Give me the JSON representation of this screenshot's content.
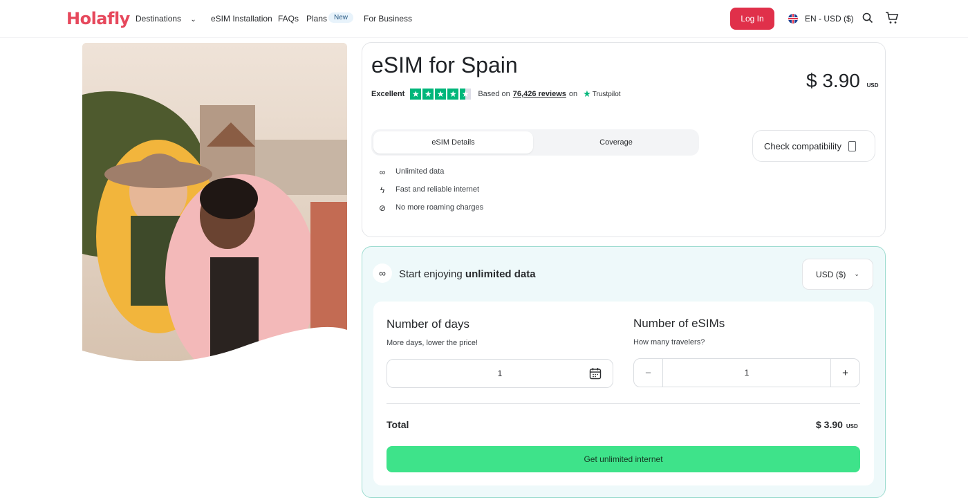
{
  "header": {
    "logo": "Holafly",
    "nav": {
      "destinations": "Destinations",
      "installation": "eSIM Installation",
      "faqs": "FAQs",
      "plans": "Plans",
      "plans_badge": "New",
      "business": "For Business"
    },
    "login_label": "Log In",
    "locale_label": "EN - USD ($)"
  },
  "product": {
    "title": "eSIM for Spain",
    "price_value": "$ 3.90",
    "price_currency": "USD",
    "rating_label": "Excellent",
    "rating_stars": 4.5,
    "reviews_prefix": "Based on",
    "reviews_count": "76,426 reviews",
    "reviews_suffix": "on",
    "trustpilot": "Trustpilot",
    "tabs": [
      "eSIM Details",
      "Coverage"
    ],
    "features": [
      "Unlimited data",
      "Fast and reliable internet",
      "No more roaming charges"
    ],
    "check_compat_label": "Check compatibility"
  },
  "config": {
    "heading_prefix": "Start enjoying",
    "heading_bold": "unlimited data",
    "currency_select": "USD ($)",
    "days": {
      "title": "Number of days",
      "subtitle": "More days, lower the price!",
      "value": "1"
    },
    "esims": {
      "title": "Number of eSIMs",
      "subtitle": "How many travelers?",
      "value": "1",
      "minus": "−",
      "plus": "+"
    },
    "total_label": "Total",
    "total_value": "$ 3.90",
    "total_currency": "USD",
    "cta_label": "Get unlimited internet"
  },
  "colors": {
    "brand": "#e6485c",
    "login": "#e0304a",
    "cta": "#3ee38a",
    "trustpilot": "#00b67a"
  }
}
